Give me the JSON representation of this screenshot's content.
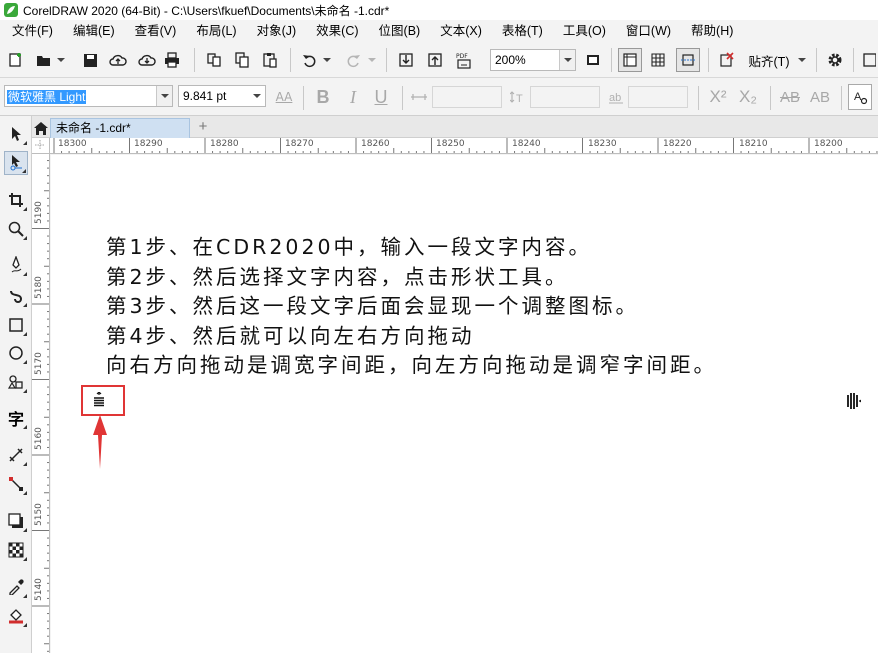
{
  "window": {
    "title": "CorelDRAW 2020 (64-Bit) - C:\\Users\\fkuef\\Documents\\未命名 -1.cdr*"
  },
  "menu": {
    "items": [
      {
        "label": "文件(F)"
      },
      {
        "label": "编辑(E)"
      },
      {
        "label": "查看(V)"
      },
      {
        "label": "布局(L)"
      },
      {
        "label": "对象(J)"
      },
      {
        "label": "效果(C)"
      },
      {
        "label": "位图(B)"
      },
      {
        "label": "文本(X)"
      },
      {
        "label": "表格(T)"
      },
      {
        "label": "工具(O)"
      },
      {
        "label": "窗口(W)"
      },
      {
        "label": "帮助(H)"
      }
    ]
  },
  "toolbar": {
    "zoom_value": "200%",
    "snap_label": "贴齐(T)",
    "pdf_label": "PDF"
  },
  "property_bar": {
    "font_family": "微软雅黑 Light",
    "font_size": "9.841 pt",
    "bold_label": "B",
    "italic_label": "I",
    "underline_label": "U",
    "superscript_label": "X²",
    "subscript_label": "X₂",
    "case_label_1": "AB",
    "case_label_2": "AB",
    "aa_label": "AA"
  },
  "tabs": {
    "document": "未命名 -1.cdr*",
    "add": "+"
  },
  "ruler": {
    "h_labels": [
      "18300",
      "18290",
      "18280",
      "18270",
      "18260",
      "18250",
      "18240",
      "18230",
      "18220",
      "18210",
      "18200"
    ],
    "v_labels": [
      "5190",
      "5180",
      "5170",
      "5160",
      "5150",
      "5140"
    ]
  },
  "canvas": {
    "lines": [
      "第1步、在CDR2020中，输入一段文字内容。",
      "第2步、然后选择文字内容，点击形状工具。",
      "第3步、然后这一段文字后面会显现一个调整图标。",
      "第4步、然后就可以向左右方向拖动",
      "向右方向拖动是调宽字间距，向左方向拖动是调窄字间距。"
    ]
  },
  "colors": {
    "accent_red": "#e03535",
    "tab_active": "#cfe0f2",
    "selection_blue": "#3399ff"
  },
  "icons": [
    "pick-tool-icon",
    "shape-tool-icon",
    "crop-tool-icon",
    "zoom-tool-icon",
    "freehand-tool-icon",
    "artistic-media-icon",
    "rectangle-tool-icon",
    "ellipse-tool-icon",
    "polygon-tool-icon",
    "text-tool-icon",
    "parallel-dimension-icon",
    "connector-tool-icon",
    "drop-shadow-icon",
    "transparency-icon",
    "eyedropper-icon",
    "fill-tool-icon"
  ]
}
